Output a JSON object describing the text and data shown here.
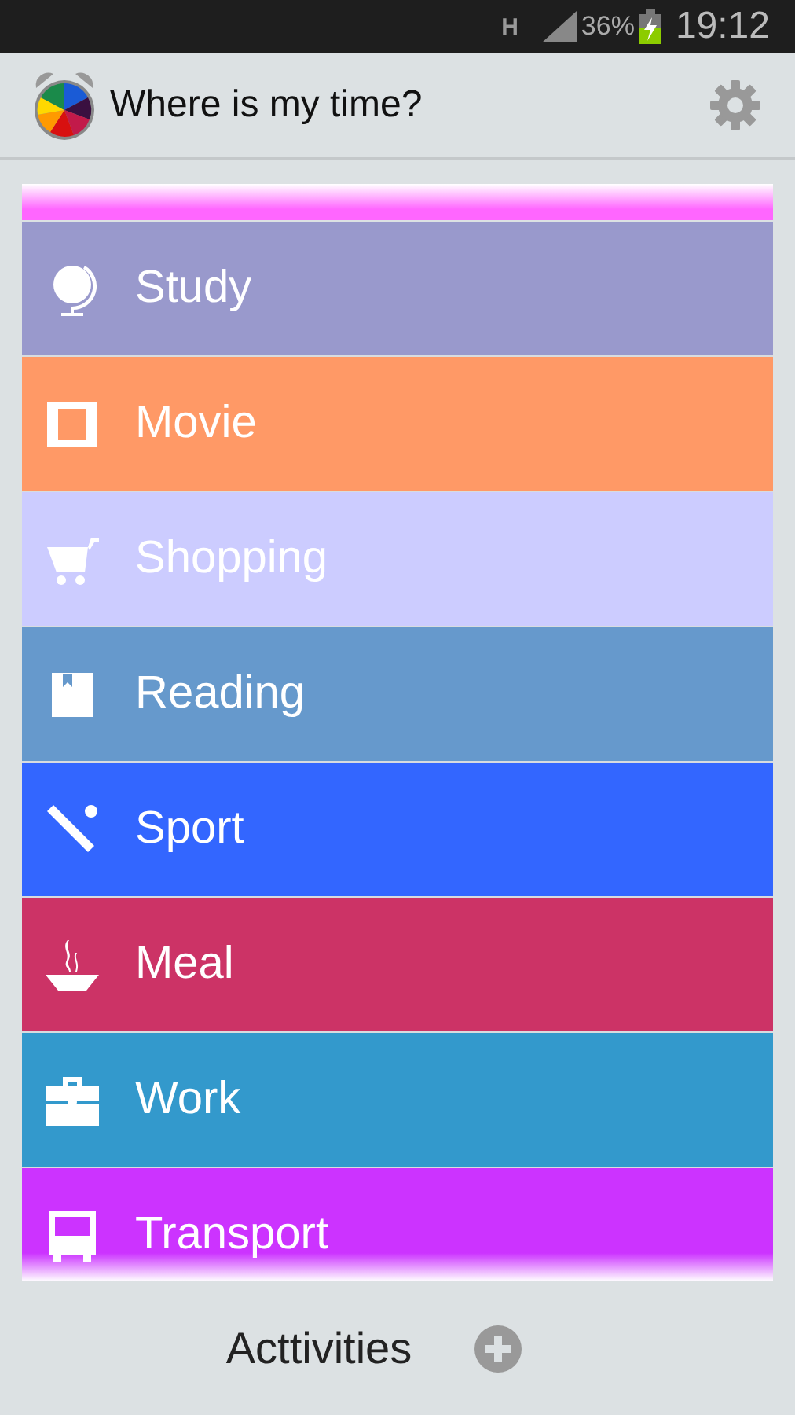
{
  "status_bar": {
    "network": "H",
    "battery": "36%",
    "time": "19:12"
  },
  "app_bar": {
    "title": "Where is my time?"
  },
  "activities": [
    {
      "kind": "study",
      "label": "Study",
      "color": "#9999cc"
    },
    {
      "kind": "movie",
      "label": "Movie",
      "color": "#ff9966"
    },
    {
      "kind": "shopping",
      "label": "Shopping",
      "color": "#ccccff"
    },
    {
      "kind": "reading",
      "label": "Reading",
      "color": "#6699cc"
    },
    {
      "kind": "sport",
      "label": "Sport",
      "color": "#3366ff"
    },
    {
      "kind": "meal",
      "label": "Meal",
      "color": "#cc3366"
    },
    {
      "kind": "work",
      "label": "Work",
      "color": "#3399cc"
    },
    {
      "kind": "transport",
      "label": "Transport",
      "color": "#cc33ff"
    }
  ],
  "footer": {
    "label": "Acttivities"
  }
}
